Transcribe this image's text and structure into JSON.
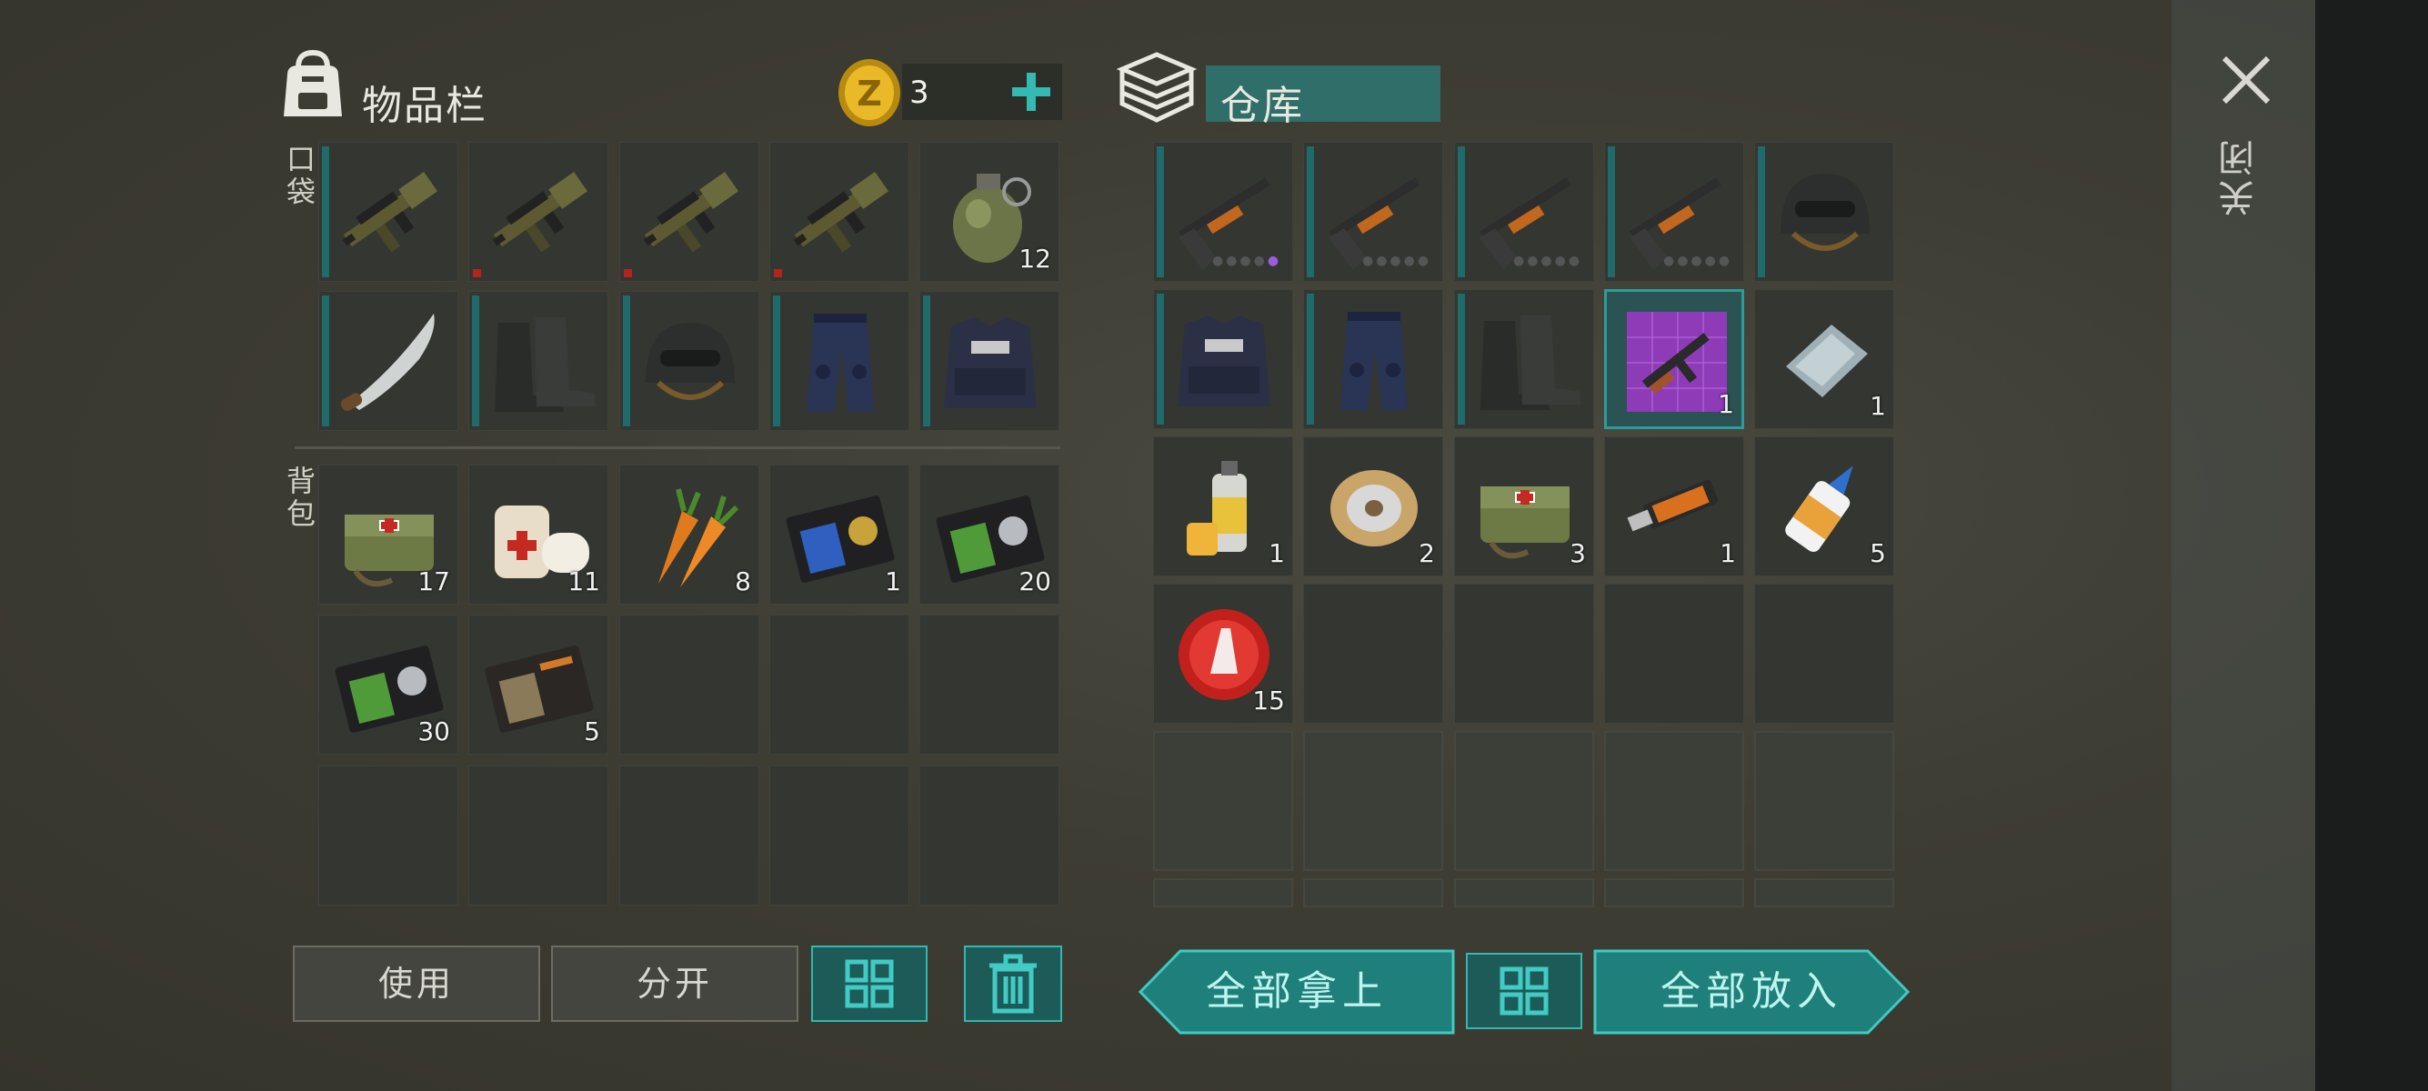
{
  "inventory": {
    "title": "物品栏",
    "coin_count": "3",
    "pocket_label": "口袋",
    "backpack_label": "背包",
    "pocket_items": [
      {
        "name": "grenade-launcher",
        "qty": "",
        "bar": true,
        "red": false
      },
      {
        "name": "grenade-launcher",
        "qty": "",
        "bar": false,
        "red": true
      },
      {
        "name": "grenade-launcher",
        "qty": "",
        "bar": false,
        "red": true
      },
      {
        "name": "grenade-launcher",
        "qty": "",
        "bar": false,
        "red": true
      },
      {
        "name": "frag-grenade",
        "qty": "12",
        "bar": false,
        "red": false
      },
      {
        "name": "machete",
        "qty": "",
        "bar": true,
        "red": false
      },
      {
        "name": "combat-boots",
        "qty": "",
        "bar": true,
        "red": false
      },
      {
        "name": "combat-helmet",
        "qty": "",
        "bar": true,
        "red": false
      },
      {
        "name": "police-pants",
        "qty": "",
        "bar": true,
        "red": false
      },
      {
        "name": "police-vest",
        "qty": "",
        "bar": true,
        "red": false
      }
    ],
    "backpack_items": [
      {
        "name": "medical-bag",
        "qty": "17"
      },
      {
        "name": "bandage",
        "qty": "11"
      },
      {
        "name": "carrots",
        "qty": "8"
      },
      {
        "name": "police-badge-blue",
        "qty": "1"
      },
      {
        "name": "police-badge-green",
        "qty": "20"
      },
      {
        "name": "police-badge-green-2",
        "qty": "30"
      },
      {
        "name": "patrol-officer-id",
        "qty": "5"
      },
      {
        "name": "empty",
        "qty": ""
      },
      {
        "name": "empty",
        "qty": ""
      },
      {
        "name": "empty",
        "qty": ""
      },
      {
        "name": "empty",
        "qty": ""
      },
      {
        "name": "empty",
        "qty": ""
      },
      {
        "name": "empty",
        "qty": ""
      },
      {
        "name": "empty",
        "qty": ""
      },
      {
        "name": "empty",
        "qty": ""
      }
    ],
    "buttons": {
      "use": "使用",
      "split": "分开"
    }
  },
  "storage": {
    "title": "仓库",
    "items": [
      {
        "name": "shotgun",
        "qty": "",
        "bar": true,
        "dots": true,
        "purple": true
      },
      {
        "name": "shotgun",
        "qty": "",
        "bar": true,
        "dots": true,
        "purple": false
      },
      {
        "name": "shotgun",
        "qty": "",
        "bar": true,
        "dots": true,
        "purple": false
      },
      {
        "name": "shotgun",
        "qty": "",
        "bar": true,
        "dots": true,
        "purple": false
      },
      {
        "name": "combat-helmet",
        "qty": "",
        "bar": true,
        "dots": false,
        "purple": false
      },
      {
        "name": "police-vest",
        "qty": "",
        "bar": true,
        "dots": false,
        "purple": false
      },
      {
        "name": "police-pants",
        "qty": "",
        "bar": true,
        "dots": false,
        "purple": false
      },
      {
        "name": "combat-boots",
        "qty": "",
        "bar": true,
        "dots": false,
        "purple": false
      },
      {
        "name": "ak-blueprint",
        "qty": "1",
        "bar": false,
        "dots": false,
        "purple": false,
        "selected": true
      },
      {
        "name": "metal-sheet",
        "qty": "1",
        "bar": false,
        "dots": false,
        "purple": false
      },
      {
        "name": "spray-paint",
        "qty": "1"
      },
      {
        "name": "wire-spool",
        "qty": "2"
      },
      {
        "name": "medical-bag",
        "qty": "3"
      },
      {
        "name": "usb-drive",
        "qty": "1"
      },
      {
        "name": "super-glue",
        "qty": "5"
      },
      {
        "name": "bottle-cap",
        "qty": "15"
      }
    ],
    "buttons": {
      "take_all": "全部拿上",
      "put_all": "全部放入"
    }
  },
  "close_label": "关闭",
  "colors": {
    "accent": "#33b7b2",
    "teal_bg": "#1d5b58",
    "bar": "#1f6a6a",
    "danger": "#b4241c",
    "selection_purple": "#9a5ce0"
  }
}
